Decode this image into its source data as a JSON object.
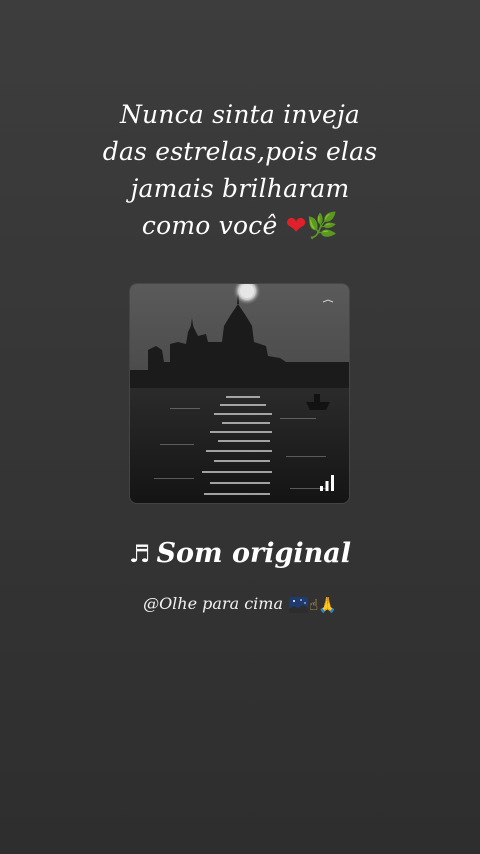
{
  "quote": {
    "line1": "Nunca sinta inveja",
    "line2": "das estrelas,pois elas",
    "line3": "jamais brilharam",
    "line4": "como  você",
    "emoji_heart": "❤",
    "emoji_leaf": "🌿"
  },
  "cover": {
    "alt_icon": "venice-night-photo",
    "playing_indicator_icon": "signal-bars-icon"
  },
  "audio": {
    "note_symbol": "♬",
    "title": "Som original",
    "artist": "@Olhe para cima",
    "emoji_pointing": "☝",
    "emoji_pray": "🙏"
  },
  "colors": {
    "background_top": "#3d3d3d",
    "background_bottom": "#2e2e2e",
    "text": "#ffffff",
    "heart": "#e0202a",
    "leaf": "#5fae3a"
  }
}
